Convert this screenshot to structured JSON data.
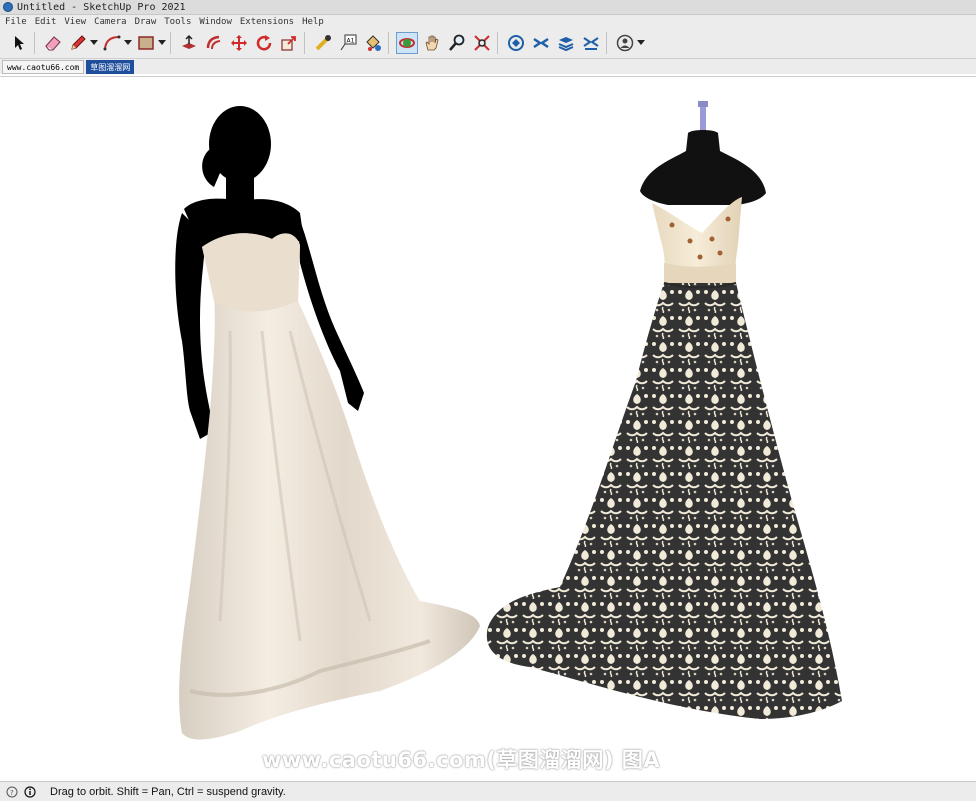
{
  "window": {
    "title": "Untitled - SketchUp Pro 2021"
  },
  "menu": [
    "File",
    "Edit",
    "View",
    "Camera",
    "Draw",
    "Tools",
    "Window",
    "Extensions",
    "Help"
  ],
  "tabs": [
    "www.caotu66.com",
    "草图溜溜网"
  ],
  "overlay": {
    "watermark": "www.caotu66.com(草图溜溜网) 图A"
  },
  "status": {
    "message": "Drag to orbit. Shift = Pan, Ctrl = suspend gravity."
  },
  "colors": {
    "active_tool_bg": "#cfe3f7",
    "selected_tab": "#1f4f9c",
    "silhouette": "#000000",
    "white_gown": "#eee5d8",
    "lace_gown": "#3a3a3a",
    "bodice": "#efe2c8"
  },
  "toolbar_icons": [
    "select-arrow-icon",
    "eraser-icon",
    "pencil-icon",
    "arc-icon",
    "rectangle-icon",
    "push-pull-icon",
    "offset-icon",
    "move-icon",
    "rotate-icon",
    "scale-icon",
    "tape-measure-icon",
    "text-icon",
    "paint-bucket-icon",
    "orbit-icon",
    "pan-icon",
    "zoom-icon",
    "zoom-extents-icon",
    "warehouse-icon",
    "extension-warehouse-icon",
    "layout-icon",
    "extension-manager-icon",
    "user-account-icon"
  ]
}
